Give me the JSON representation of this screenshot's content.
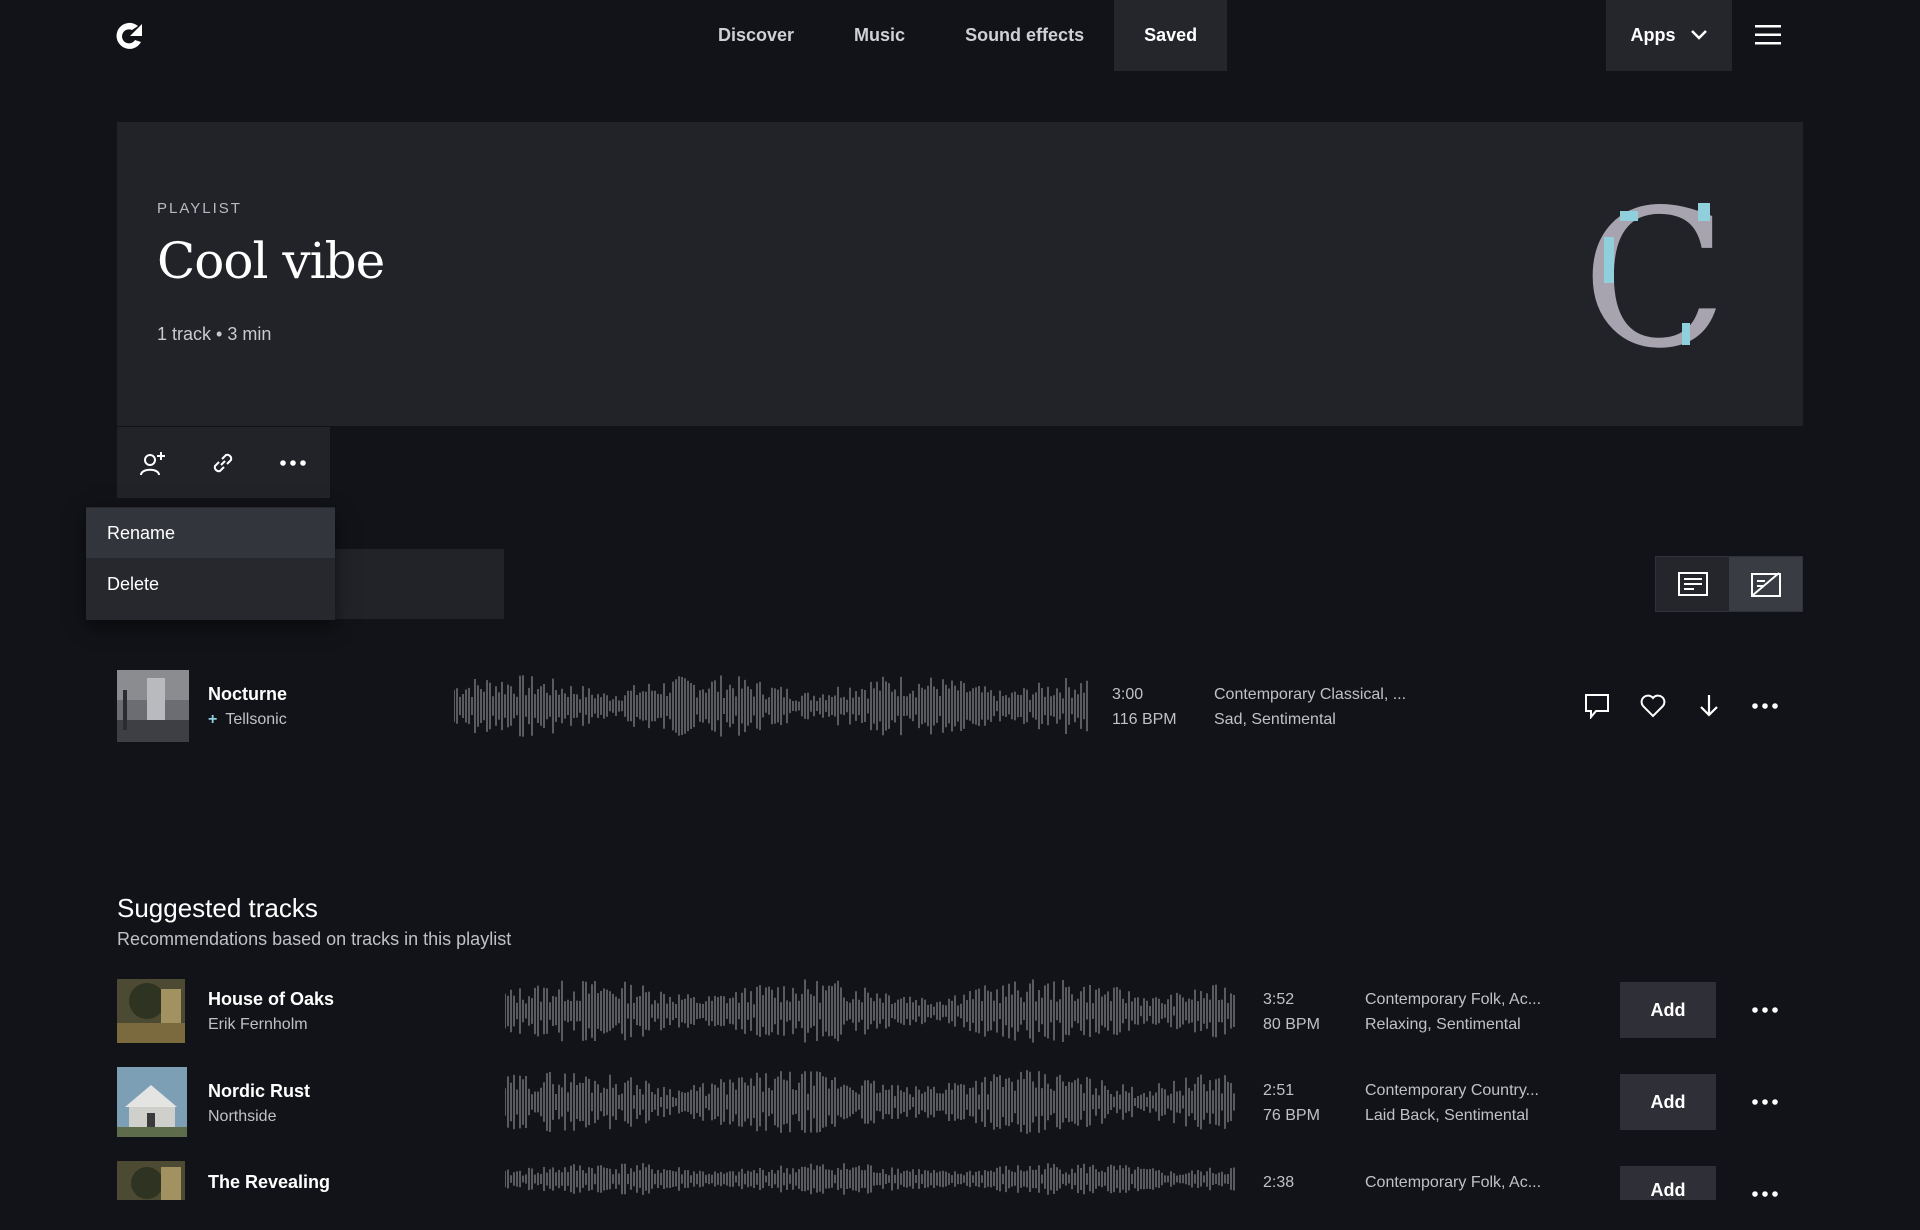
{
  "nav": {
    "items": [
      {
        "label": "Discover",
        "active": false
      },
      {
        "label": "Music",
        "active": false
      },
      {
        "label": "Sound effects",
        "active": false
      },
      {
        "label": "Saved",
        "active": true
      }
    ],
    "apps_label": "Apps"
  },
  "playlist": {
    "kicker": "PLAYLIST",
    "title": "Cool vibe",
    "meta": "1 track • 3 min",
    "cover_letter": "C"
  },
  "actions_menu": {
    "items": [
      "Rename",
      "Delete"
    ]
  },
  "tracks": [
    {
      "title": "Nocturne",
      "artist": "Tellsonic",
      "duration": "3:00",
      "bpm": "116 BPM",
      "genres": "Contemporary Classical, ...",
      "moods": "Sad, Sentimental"
    }
  ],
  "suggested": {
    "title": "Suggested tracks",
    "subtitle": "Recommendations based on tracks in this playlist",
    "add_label": "Add",
    "tracks": [
      {
        "title": "House of Oaks",
        "artist": "Erik Fernholm",
        "duration": "3:52",
        "bpm": "80 BPM",
        "genres": "Contemporary Folk, Ac...",
        "moods": "Relaxing, Sentimental"
      },
      {
        "title": "Nordic Rust",
        "artist": "Northside",
        "duration": "2:51",
        "bpm": "76 BPM",
        "genres": "Contemporary Country...",
        "moods": "Laid Back, Sentimental"
      },
      {
        "title": "The Revealing",
        "artist": "",
        "duration": "2:38",
        "bpm": "",
        "genres": "Contemporary Folk, Ac...",
        "moods": ""
      }
    ]
  },
  "colors": {
    "background": "#121318",
    "panel": "#222329",
    "cover_gray": "#a7a4b0",
    "cover_accent": "#8fd0dc",
    "waveform": "#5a5b61"
  }
}
